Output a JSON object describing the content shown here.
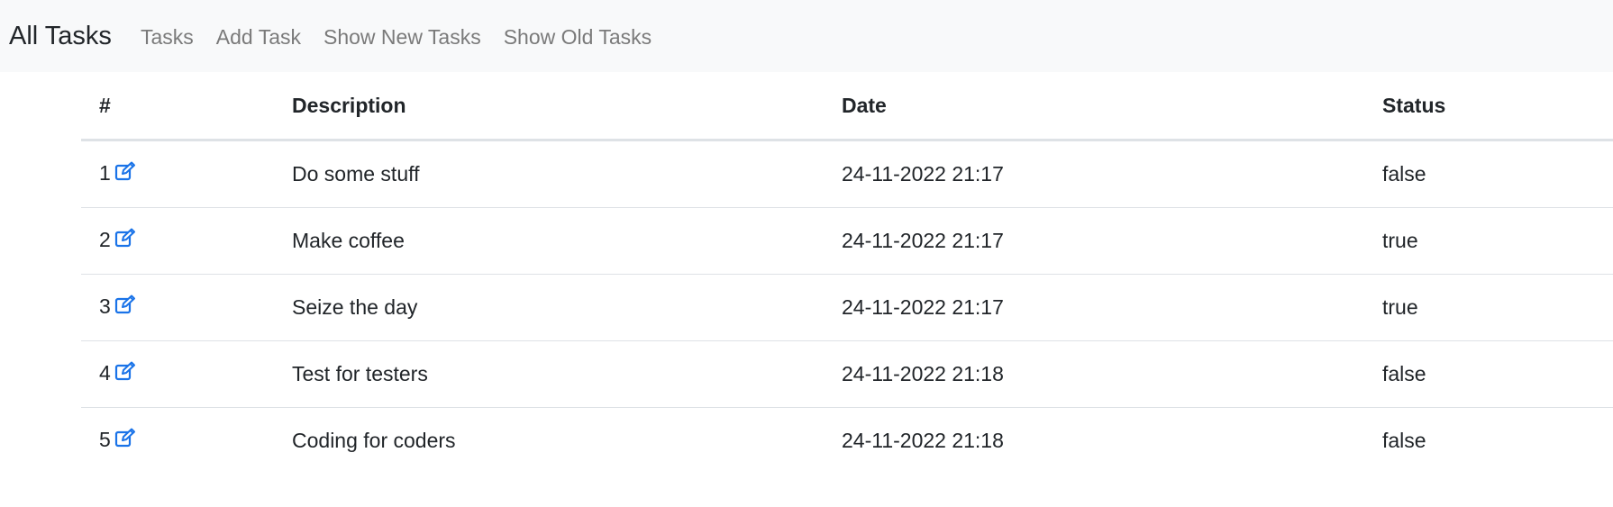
{
  "navbar": {
    "brand": "All Tasks",
    "links": [
      {
        "label": "Tasks"
      },
      {
        "label": "Add Task"
      },
      {
        "label": "Show New Tasks"
      },
      {
        "label": "Show Old Tasks"
      }
    ]
  },
  "table": {
    "headers": {
      "id": "#",
      "description": "Description",
      "date": "Date",
      "status": "Status"
    },
    "rows": [
      {
        "id": "1",
        "description": "Do some stuff",
        "date": "24-11-2022 21:17",
        "status": "false",
        "icon": "edit-icon"
      },
      {
        "id": "2",
        "description": "Make coffee",
        "date": "24-11-2022 21:17",
        "status": "true",
        "icon": "edit-icon"
      },
      {
        "id": "3",
        "description": "Seize the day",
        "date": "24-11-2022 21:17",
        "status": "true",
        "icon": "edit-icon"
      },
      {
        "id": "4",
        "description": "Test for testers",
        "date": "24-11-2022 21:18",
        "status": "false",
        "icon": "edit-icon"
      },
      {
        "id": "5",
        "description": "Coding for coders",
        "date": "24-11-2022 21:18",
        "status": "false",
        "icon": "edit-icon"
      }
    ]
  },
  "colors": {
    "navbar_bg": "#f8f9fa",
    "link_muted": "#7a7a7a",
    "edit_icon": "#1a73e8",
    "text": "#212529"
  }
}
